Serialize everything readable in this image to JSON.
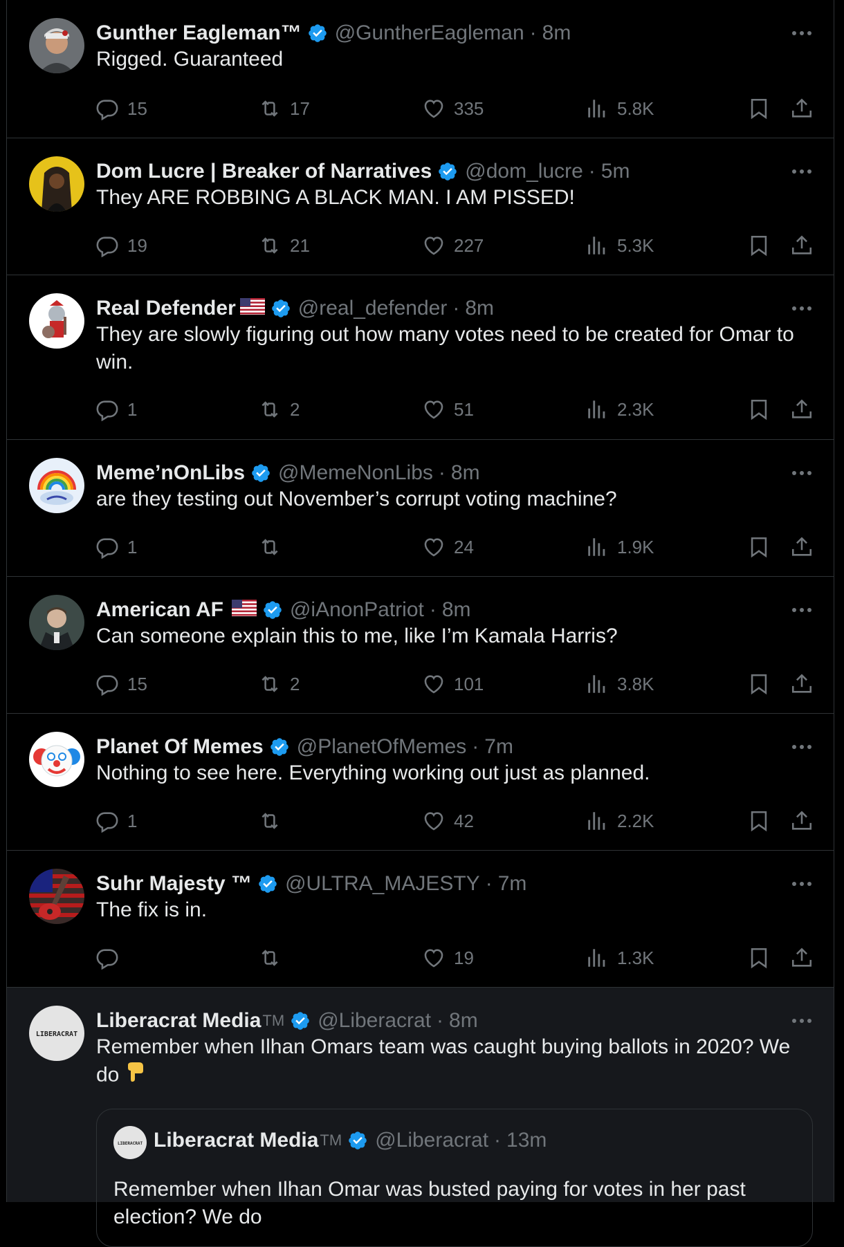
{
  "tweets": [
    {
      "name": "Gunther Eagleman™",
      "tm": "",
      "flag": false,
      "handle": "@GuntherEagleman",
      "time": "8m",
      "text": "Rigged.  Guaranteed",
      "replies": "15",
      "retweets": "17",
      "likes": "335",
      "views": "5.8K",
      "avatar": "avatar-gunther"
    },
    {
      "name": "Dom Lucre | Breaker of Narratives",
      "tm": "",
      "flag": false,
      "handle": "@dom_lucre",
      "time": "5m",
      "text": "They ARE ROBBING A BLACK MAN. I AM PISSED!",
      "replies": "19",
      "retweets": "21",
      "likes": "227",
      "views": "5.3K",
      "avatar": "avatar-dom"
    },
    {
      "name": "Real Defender",
      "tm": "",
      "flag": true,
      "handle": "@real_defender",
      "time": "8m",
      "text": "They are slowly figuring out how many votes need to be created for Omar to win.",
      "replies": "1",
      "retweets": "2",
      "likes": "51",
      "views": "2.3K",
      "avatar": "avatar-defender"
    },
    {
      "name": "Meme’nOnLibs",
      "tm": "",
      "flag": false,
      "handle": "@MemeNonLibs",
      "time": "8m",
      "text": "are they testing out November’s corrupt voting machine?",
      "replies": "1",
      "retweets": "",
      "likes": "24",
      "views": "1.9K",
      "avatar": "avatar-memes-libs"
    },
    {
      "name": "American AF",
      "tm": "",
      "flag": true,
      "handle": "@iAnonPatriot",
      "time": "8m",
      "text": "Can someone explain this to me, like I’m Kamala Harris?",
      "replies": "15",
      "retweets": "2",
      "likes": "101",
      "views": "3.8K",
      "avatar": "avatar-american"
    },
    {
      "name": "Planet Of Memes",
      "tm": "",
      "flag": false,
      "handle": "@PlanetOfMemes",
      "time": "7m",
      "text": "Nothing to see here. Everything working out just as planned.",
      "replies": "1",
      "retweets": "",
      "likes": "42",
      "views": "2.2K",
      "avatar": "avatar-clown"
    },
    {
      "name": "Suhr Majesty ™",
      "tm": "",
      "flag": false,
      "handle": "@ULTRA_MAJESTY",
      "time": "7m",
      "text": "The fix is in.",
      "replies": "",
      "retweets": "",
      "likes": "19",
      "views": "1.3K",
      "avatar": "avatar-guitar"
    }
  ],
  "highlight": {
    "name": "Liberacrat Media",
    "tm": "TM",
    "handle": "@Liberacrat",
    "time": "8m",
    "text": "Remember when Ilhan Omars team was caught buying ballots in 2020? We do",
    "emoji": "pointing-down-hand-icon",
    "avatar_text": "LIBERACRAT",
    "quote": {
      "name": "Liberacrat Media",
      "tm": "TM",
      "handle": "@Liberacrat",
      "time": "13m",
      "text": "Remember when Ilhan Omar was busted paying for votes in her past election? We do",
      "avatar_text": "LIBERACRAT"
    }
  },
  "separator": "·",
  "colors": {
    "background": "#000000",
    "text": "#e7e9ea",
    "muted": "#71767b",
    "verified": "#1d9bf0",
    "border": "#2f3336"
  }
}
